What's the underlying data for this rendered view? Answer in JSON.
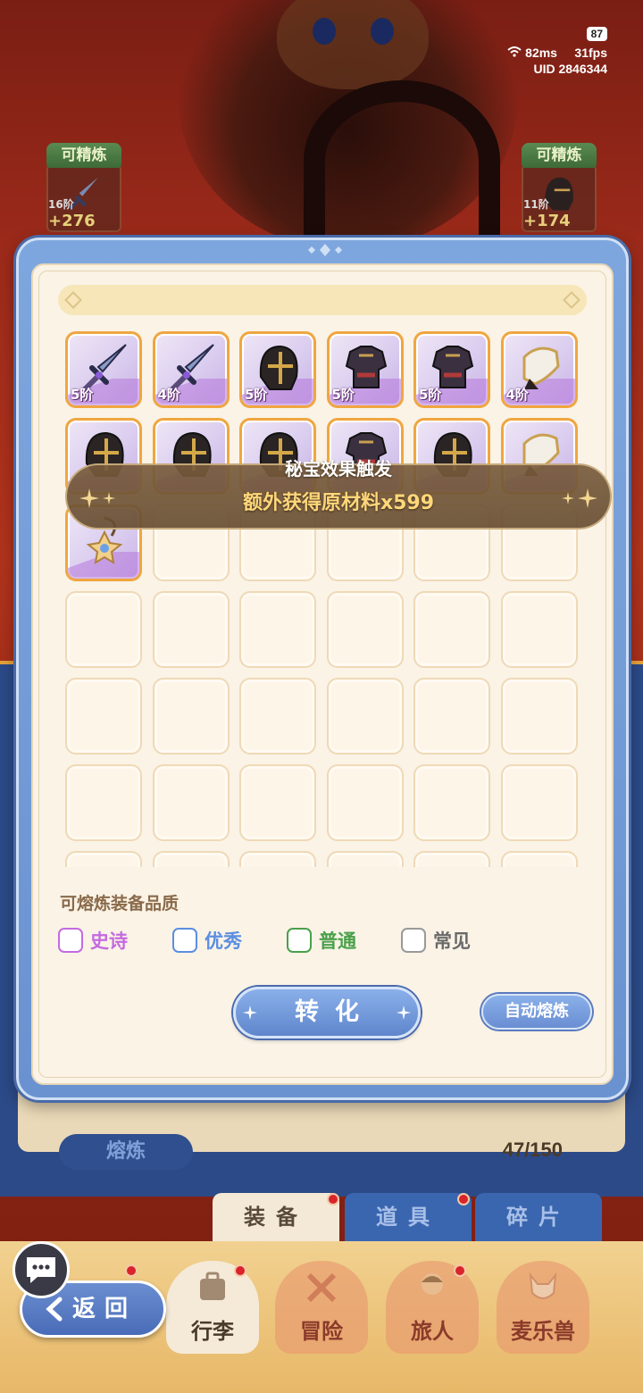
{
  "status": {
    "battery": "87",
    "ping": "82ms",
    "fps": "31fps",
    "uid_label": "UID",
    "uid": "2846344"
  },
  "refine_cards": [
    {
      "tag": "可精炼",
      "tier": "16阶",
      "plus": "+276"
    },
    {
      "tag": "可精炼",
      "tier": "11阶",
      "plus": "+174"
    }
  ],
  "dialog": {
    "toast": {
      "title": "秘宝效果触发",
      "message": "额外获得原材料x599"
    },
    "items": [
      {
        "icon": "sword-icon",
        "tier": "5阶"
      },
      {
        "icon": "sword-icon",
        "tier": "4阶"
      },
      {
        "icon": "helmet-icon",
        "tier": "5阶"
      },
      {
        "icon": "armor-icon",
        "tier": "5阶"
      },
      {
        "icon": "armor-icon",
        "tier": "5阶"
      },
      {
        "icon": "gauntlet-icon",
        "tier": "4阶"
      },
      {
        "icon": "helmet-icon",
        "tier": ""
      },
      {
        "icon": "helmet-icon",
        "tier": ""
      },
      {
        "icon": "helmet-icon",
        "tier": ""
      },
      {
        "icon": "armor-icon",
        "tier": ""
      },
      {
        "icon": "helmet-icon",
        "tier": ""
      },
      {
        "icon": "gauntlet-icon",
        "tier": ""
      },
      {
        "icon": "amulet-icon",
        "tier": ""
      }
    ],
    "quality_title": "可熔炼装备品质",
    "qualities": [
      {
        "label": "史诗",
        "color": "#c46be0"
      },
      {
        "label": "优秀",
        "color": "#5b8ee0"
      },
      {
        "label": "普通",
        "color": "#4aa04a"
      },
      {
        "label": "常见",
        "color": "#6a6a6a"
      }
    ],
    "convert_label": "转化",
    "auto_label": "自动熔炼"
  },
  "background": {
    "melt_label": "熔炼",
    "capacity": "47/150",
    "subtabs": [
      "装备",
      "道具",
      "碎片"
    ]
  },
  "nav": {
    "back_label": "返回",
    "items": [
      "行李",
      "冒险",
      "旅人",
      "麦乐兽"
    ]
  },
  "colors": {
    "accent_blue": "#6a92d0",
    "gold_text": "#ffd77a",
    "epic_purple": "#c46be0"
  }
}
